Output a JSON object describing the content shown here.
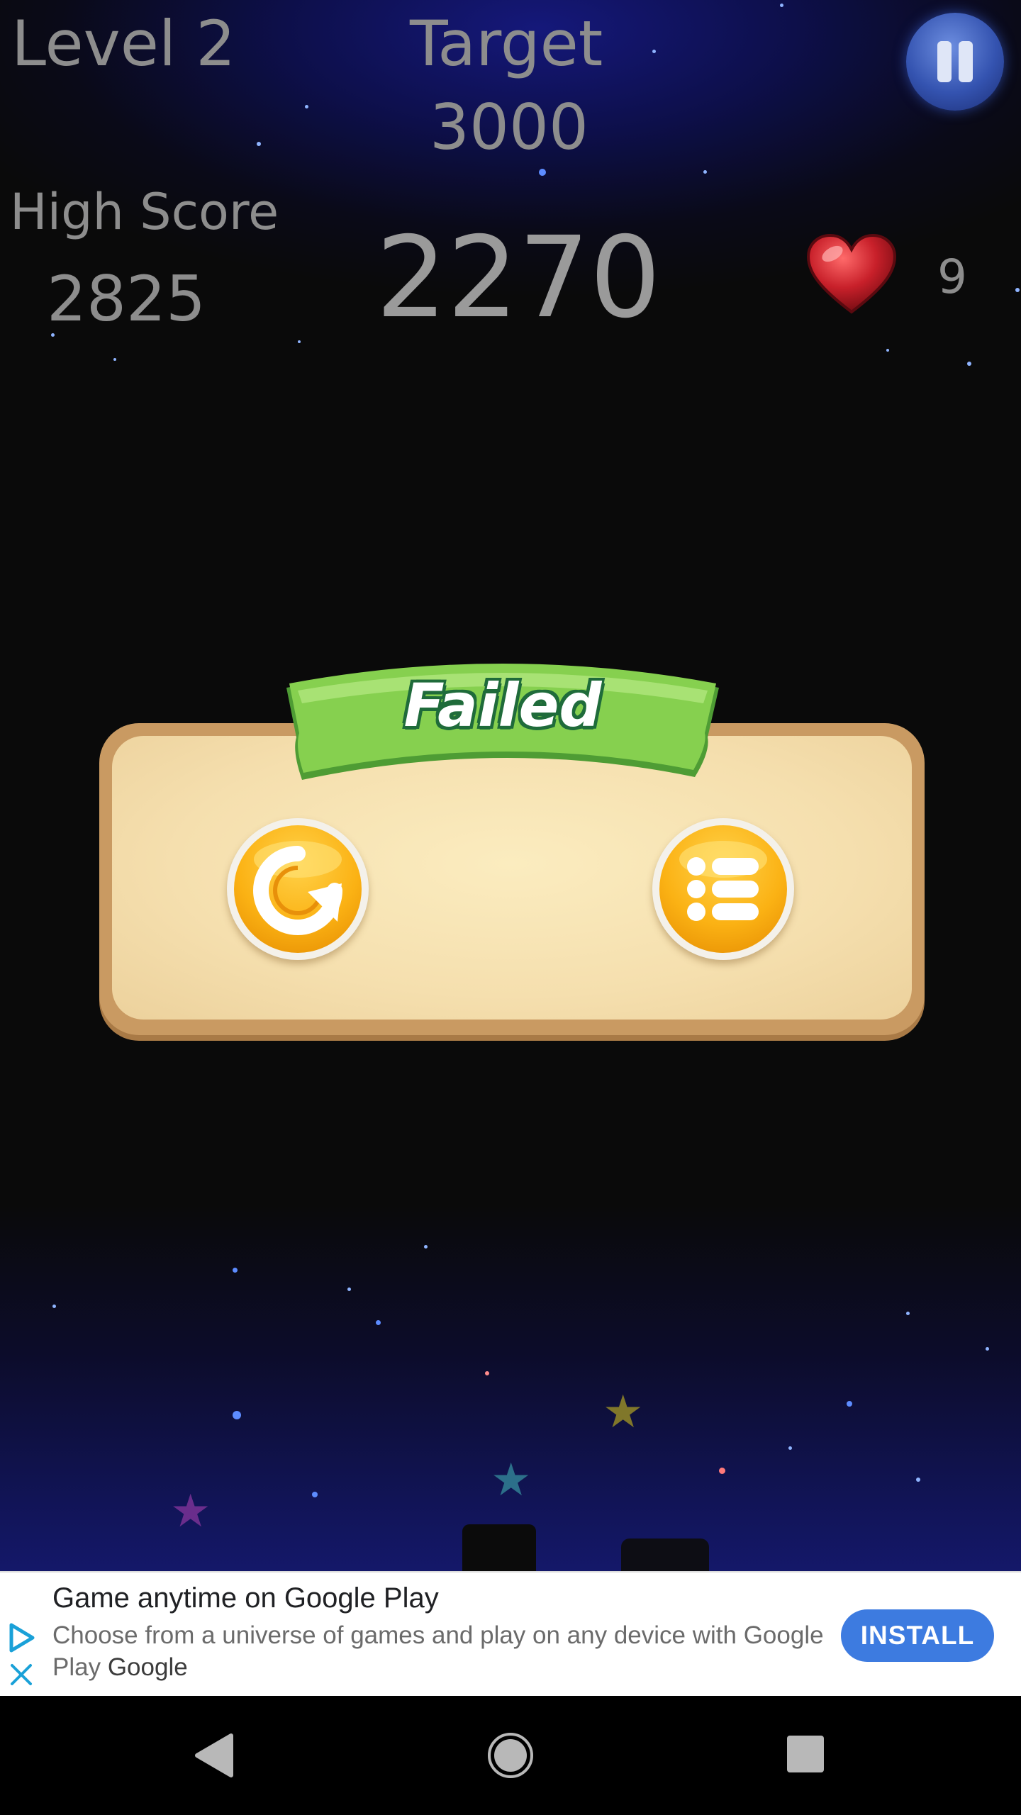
{
  "hud": {
    "level_label": "Level 2",
    "target_label": "Target",
    "target_value": "3000",
    "high_score_label": "High Score",
    "high_score_value": "2825",
    "score_value": "2270",
    "lives_value": "9"
  },
  "dialog": {
    "title": "Failed",
    "buttons": [
      {
        "name": "retry",
        "icon": "retry-icon"
      },
      {
        "name": "level-menu",
        "icon": "list-icon"
      }
    ]
  },
  "ad": {
    "title": "Game anytime on Google Play",
    "body": "Choose from a universe of games and play on any device with Google Play",
    "brand": "Google",
    "install_label": "INSTALL",
    "icons": [
      "google-play-icon",
      "close-icon"
    ]
  },
  "navbar": {
    "icons": [
      "back-icon",
      "home-icon",
      "recents-icon"
    ]
  },
  "colors": {
    "hud_text": "#8d8d8d",
    "ribbon_green": "#7fc94a",
    "button_orange": "#fbb214",
    "install_blue": "#3d7be0",
    "heart_red": "#c8202a"
  }
}
